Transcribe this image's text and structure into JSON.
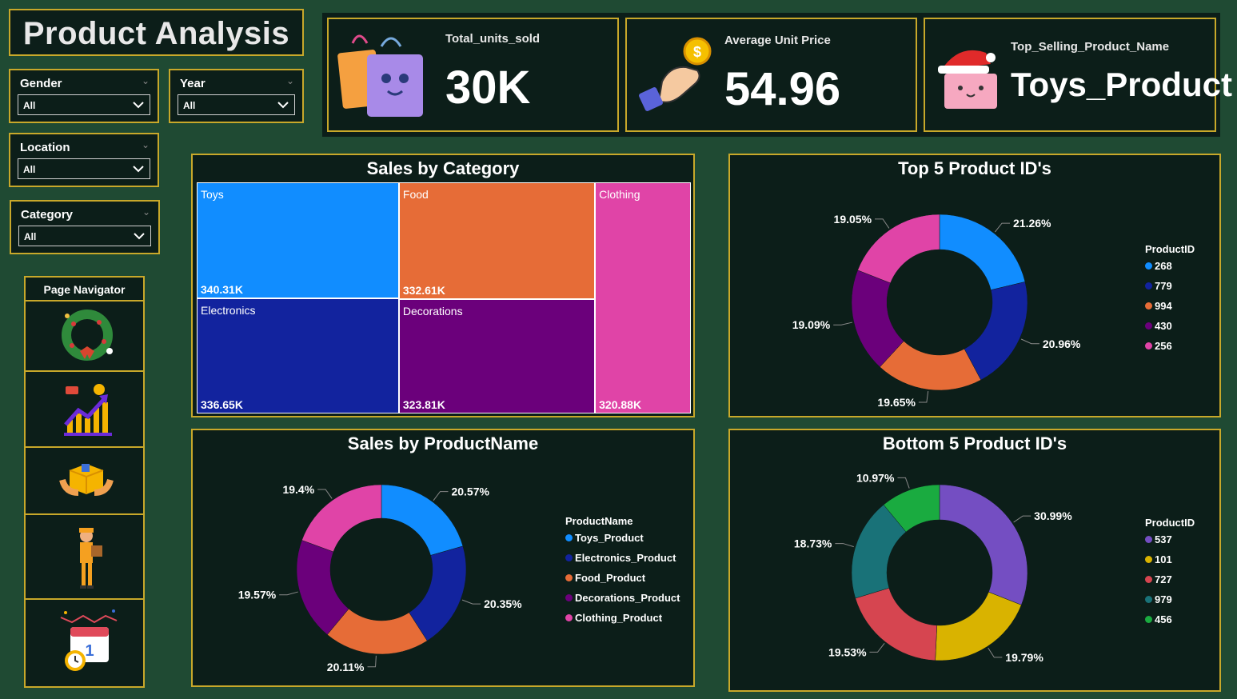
{
  "page": {
    "title": "Product Analysis"
  },
  "slicers": {
    "gender": {
      "label": "Gender",
      "value": "All"
    },
    "year": {
      "label": "Year",
      "value": "All"
    },
    "location": {
      "label": "Location",
      "value": "All"
    },
    "category": {
      "label": "Category",
      "value": "All"
    }
  },
  "navigator": {
    "title": "Page Navigator",
    "buttons": [
      {
        "icon": "christmas-wreath-icon"
      },
      {
        "icon": "growth-chart-icon"
      },
      {
        "icon": "package-box-icon"
      },
      {
        "icon": "delivery-person-icon"
      },
      {
        "icon": "calendar-clock-icon"
      }
    ]
  },
  "kpis": {
    "units": {
      "label": "Total_units_sold",
      "value": "30K",
      "icon": "shopping-bags-icon"
    },
    "price": {
      "label": "Average Unit Price",
      "value": "54.96",
      "icon": "hand-coin-icon"
    },
    "top": {
      "label": "Top_Selling_Product_Name",
      "value": "Toys_Product",
      "icon": "santa-gift-bag-icon"
    }
  },
  "colors": {
    "background": "#1f4a33",
    "panel": "#0c1e19",
    "border": "#c8a82a",
    "blue": "#118dff",
    "navy": "#12239e",
    "orange": "#e66c37",
    "purple": "#6b007b",
    "pink": "#e044a7",
    "violet": "#744ec2",
    "yellow": "#d9b300",
    "red": "#d64550",
    "teal": "#197278",
    "green": "#1aab40"
  },
  "chart_data": [
    {
      "id": "sales_by_category",
      "type": "treemap",
      "title": "Sales by Category",
      "categories": [
        "Toys",
        "Electronics",
        "Food",
        "Decorations",
        "Clothing"
      ],
      "values": [
        340.31,
        336.65,
        332.61,
        323.81,
        320.88
      ],
      "labels": [
        "340.31K",
        "336.65K",
        "332.61K",
        "323.81K",
        "320.88K"
      ],
      "colors": [
        "#118dff",
        "#12239e",
        "#e66c37",
        "#6b007b",
        "#e044a7"
      ]
    },
    {
      "id": "top5_product_ids",
      "type": "pie",
      "title": "Top 5 Product ID's",
      "legend_title": "ProductID",
      "categories": [
        "268",
        "779",
        "994",
        "430",
        "256"
      ],
      "values": [
        21.26,
        20.96,
        19.65,
        19.09,
        19.05
      ],
      "labels": [
        "21.26%",
        "20.96%",
        "19.65%",
        "19.09%",
        "19.05%"
      ],
      "colors": [
        "#118dff",
        "#12239e",
        "#e66c37",
        "#6b007b",
        "#e044a7"
      ],
      "legend_position": "right"
    },
    {
      "id": "sales_by_productname",
      "type": "pie",
      "title": "Sales by ProductName",
      "legend_title": "ProductName",
      "categories": [
        "Toys_Product",
        "Electronics_Product",
        "Food_Product",
        "Decorations_Product",
        "Clothing_Product"
      ],
      "values": [
        20.57,
        20.35,
        20.11,
        19.57,
        19.4
      ],
      "labels": [
        "20.57%",
        "20.35%",
        "20.11%",
        "19.57%",
        "19.4%"
      ],
      "colors": [
        "#118dff",
        "#12239e",
        "#e66c37",
        "#6b007b",
        "#e044a7"
      ],
      "legend_position": "right"
    },
    {
      "id": "bottom5_product_ids",
      "type": "pie",
      "title": "Bottom 5 Product ID's",
      "legend_title": "ProductID",
      "categories": [
        "537",
        "101",
        "727",
        "979",
        "456"
      ],
      "values": [
        30.99,
        19.79,
        19.53,
        18.73,
        10.97
      ],
      "labels": [
        "30.99%",
        "19.79%",
        "19.53%",
        "18.73%",
        "10.97%"
      ],
      "colors": [
        "#744ec2",
        "#d9b300",
        "#d64550",
        "#197278",
        "#1aab40"
      ],
      "legend_position": "right"
    }
  ]
}
